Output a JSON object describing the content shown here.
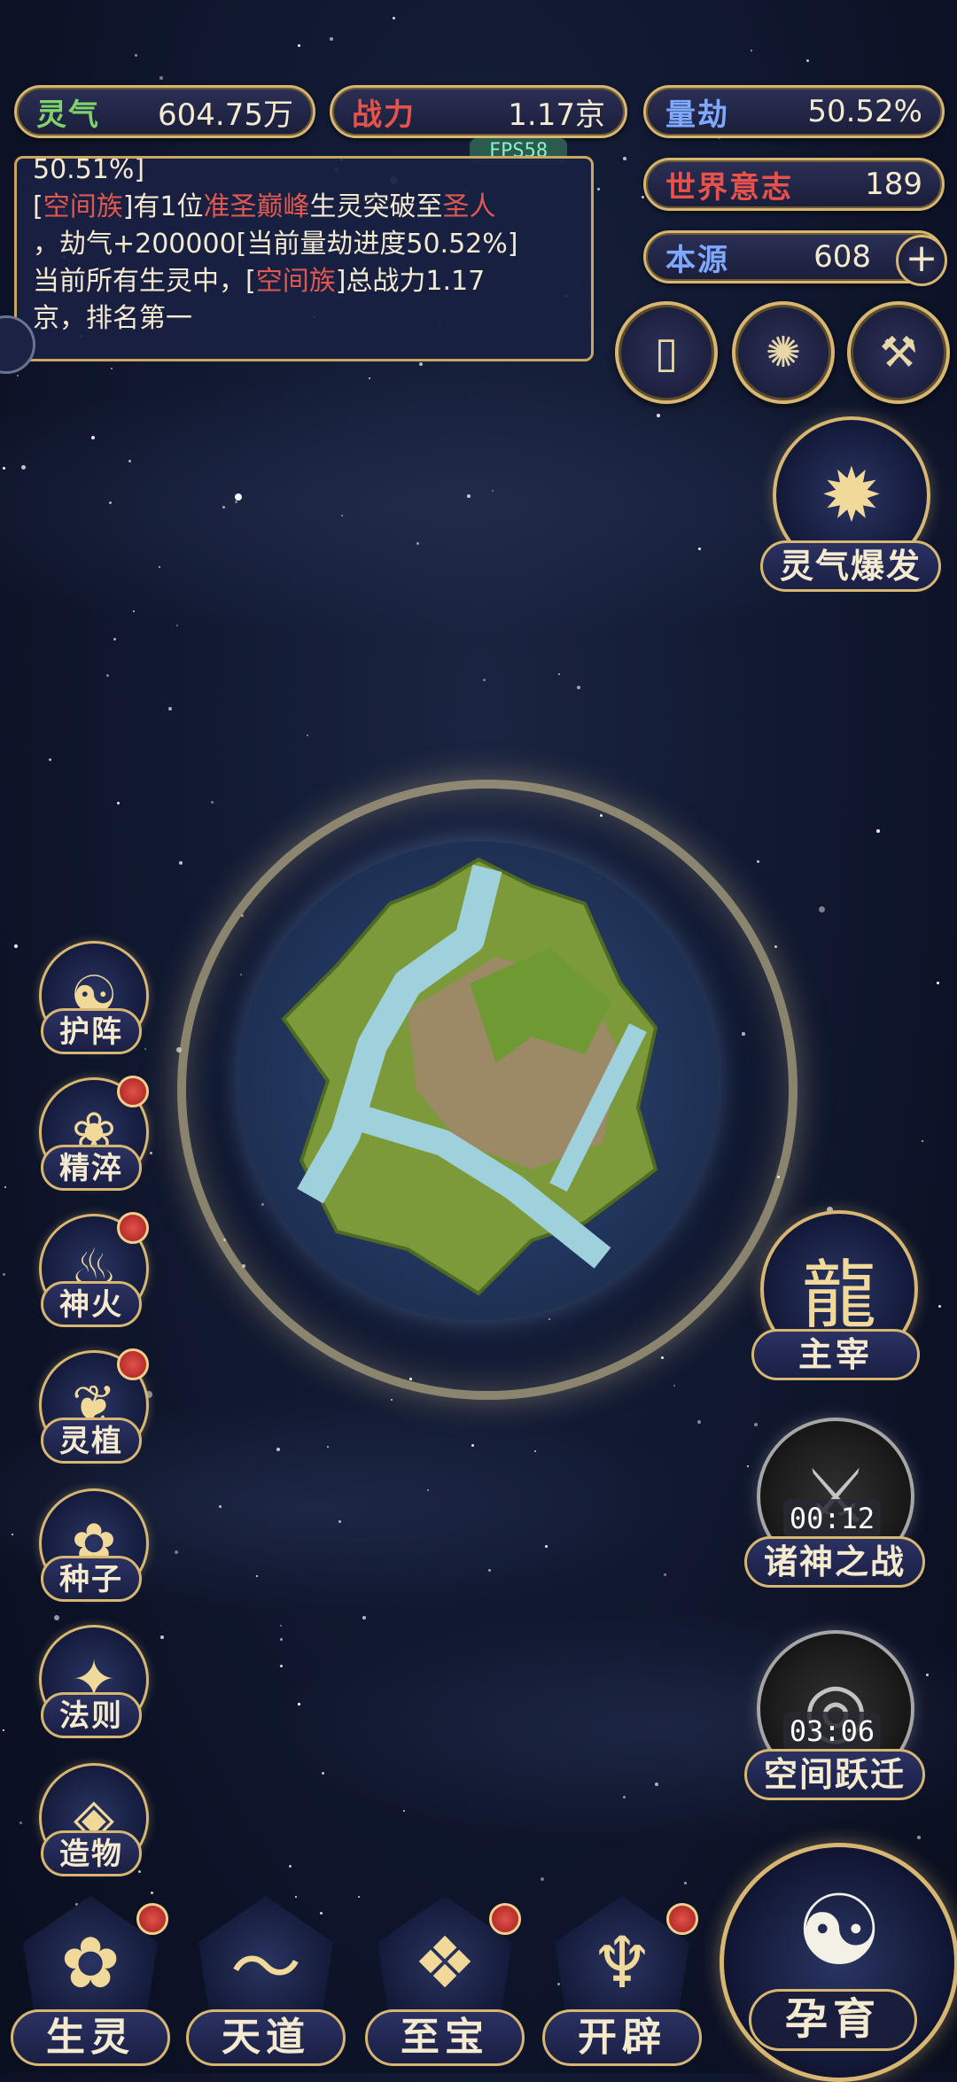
{
  "resources": {
    "lingqi": {
      "label": "灵气",
      "value": "604.75万",
      "color": "#7fd36a"
    },
    "zhanli": {
      "label": "战力",
      "value": "1.17京",
      "color": "#e8524a"
    },
    "liangjie": {
      "label": "量劫",
      "value": "50.52%",
      "color": "#7fa8ff"
    },
    "shijie": {
      "label": "世界意志",
      "value": "189",
      "color": "#e8524a"
    },
    "benyuan": {
      "label": "本源",
      "value": "608",
      "color": "#7fa8ff"
    }
  },
  "fps": "FPS58",
  "log": {
    "line0": "50.51%]",
    "l1_a": "[",
    "l1_race": "空间族",
    "l1_b": "]有1位",
    "l1_rank": "准圣巅峰",
    "l1_c": "生灵突破至",
    "l1_target": "圣人",
    "l2": "，劫气+200000[当前量劫进度50.52%]",
    "l3_a": "当前所有生灵中，[",
    "l3_race": "空间族",
    "l3_b": "]总战力1.17",
    "l4": "京，排名第一"
  },
  "top_icons": [
    "card-icon",
    "vortex-icon",
    "hammer-icon"
  ],
  "burst": {
    "label": "灵气爆发"
  },
  "left_skills": [
    {
      "label": "护阵",
      "icon": "taiji-icon",
      "badge": false
    },
    {
      "label": "精淬",
      "icon": "flame-lotus-icon",
      "badge": true
    },
    {
      "label": "神火",
      "icon": "fire-icon",
      "badge": true
    },
    {
      "label": "灵植",
      "icon": "plant-icon",
      "badge": true
    },
    {
      "label": "种子",
      "icon": "flower-icon",
      "badge": false
    },
    {
      "label": "法则",
      "icon": "rune-icon",
      "badge": false
    },
    {
      "label": "造物",
      "icon": "diamond-icon",
      "badge": false
    }
  ],
  "right_features": [
    {
      "label": "主宰",
      "icon": "dragon-icon"
    },
    {
      "label": "诸神之战",
      "icon": "sword-icon",
      "timer": "00:12"
    },
    {
      "label": "空间跃迁",
      "icon": "portal-icon",
      "timer": "03:06"
    }
  ],
  "bottom": [
    {
      "label": "生灵",
      "icon": "phoenix-icon",
      "badge": true
    },
    {
      "label": "天道",
      "icon": "wave-icon",
      "badge": false
    },
    {
      "label": "至宝",
      "icon": "treasure-icon",
      "badge": true
    },
    {
      "label": "开辟",
      "icon": "axe-icon",
      "badge": true
    }
  ],
  "main_action": {
    "label": "孕育",
    "icon": "embryo-icon"
  },
  "colors": {
    "gold": "#d7b672",
    "panel": "#1a1f44",
    "badge": "#c8322e"
  }
}
